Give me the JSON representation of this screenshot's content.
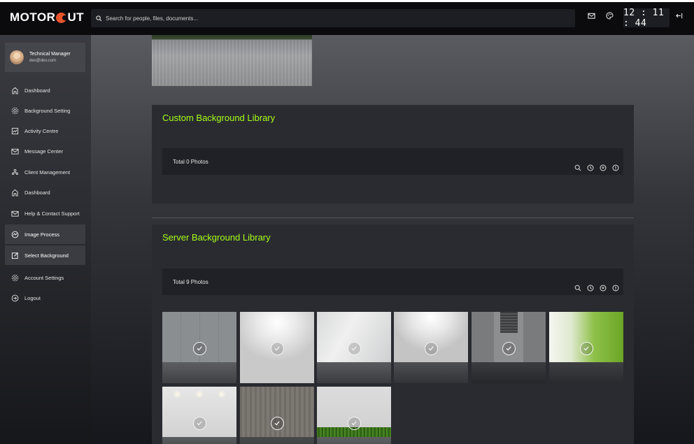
{
  "app": {
    "logo_left": "MOTOR",
    "logo_right": "UT",
    "search_placeholder": "Search for people, files, documents...",
    "clock": "12 : 11 : 44",
    "icons": [
      "mail-icon",
      "palette-icon",
      "logout-arrow-icon"
    ]
  },
  "profile": {
    "name": "Technical Manager",
    "email": "dev@dev.com"
  },
  "sidebar": {
    "items": [
      {
        "label": "Dashboard",
        "icon": "home-icon"
      },
      {
        "label": "Background Setting",
        "icon": "gear-icon"
      },
      {
        "label": "Activity Centre",
        "icon": "activity-icon"
      },
      {
        "label": "Message Center",
        "icon": "mail-icon"
      },
      {
        "label": "Client Management",
        "icon": "users-icon"
      },
      {
        "label": "Dashboard",
        "icon": "home-icon"
      },
      {
        "label": "Help & Contact Support",
        "icon": "mail-icon"
      },
      {
        "label": "Image Process",
        "icon": "process-icon"
      },
      {
        "label": "Select Background",
        "icon": "edit-image-icon"
      },
      {
        "label": "Account Settings",
        "icon": "gear-icon"
      },
      {
        "label": "Logout",
        "icon": "logout-icon"
      }
    ],
    "active": [
      "Image Process",
      "Select Background"
    ]
  },
  "custom_library": {
    "title": "Custom Background Library",
    "count": "Total 0 Photos"
  },
  "server_library": {
    "title": "Server Background Library",
    "count": "Total 9 Photos"
  },
  "toolbar_icons": [
    "search-icon",
    "history-icon",
    "filter-icon",
    "info-icon"
  ],
  "thumbnails": [
    {
      "name": "concrete-wall"
    },
    {
      "name": "white-spotlight-studio"
    },
    {
      "name": "white-light-wall"
    },
    {
      "name": "white-spotlight-dark-floor"
    },
    {
      "name": "grey-concrete-panel"
    },
    {
      "name": "green-mosaic"
    },
    {
      "name": "white-wall-lights"
    },
    {
      "name": "wood-concrete-wall"
    },
    {
      "name": "white-wall-grass"
    }
  ],
  "colors": {
    "accent_green": "#a6ff1a",
    "logo_orange": "#e8542a"
  }
}
